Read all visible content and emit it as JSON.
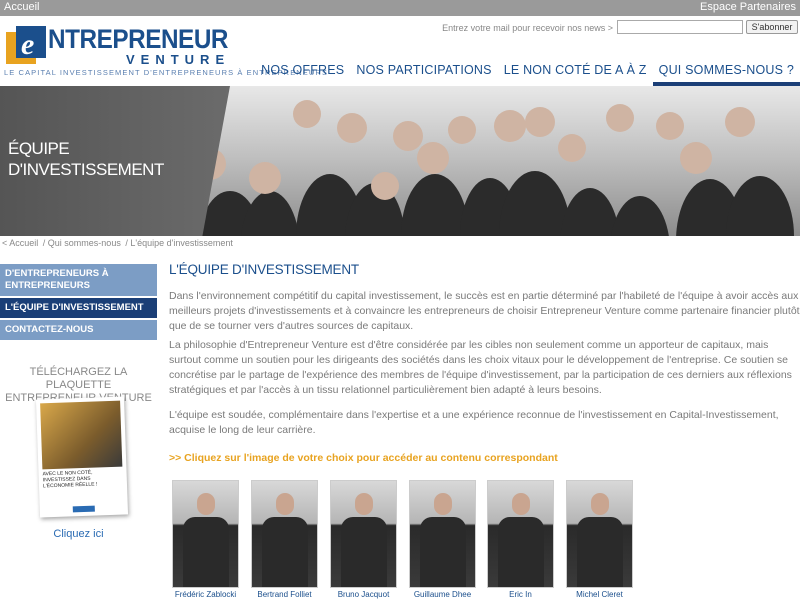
{
  "topbar": {
    "left": "Accueil",
    "right": "Espace Partenaires"
  },
  "logo": {
    "letter": "e",
    "word1": "NTREPRENEUR",
    "word2": "VENTURE",
    "tagline": "LE CAPITAL INVESTISSEMENT D'ENTREPRENEURS À ENTREPRENEURS"
  },
  "newsletter": {
    "label": "Entrez votre mail pour recevoir nos news >",
    "value": "",
    "button": "S'abonner"
  },
  "nav": [
    "NOS OFFRES",
    "NOS PARTICIPATIONS",
    "LE NON COTÉ DE A À Z",
    "QUI SOMMES-NOUS ?"
  ],
  "banner": {
    "title_line1": "ÉQUIPE",
    "title_line2": "D'INVESTISSEMENT"
  },
  "breadcrumb": [
    "< Accueil",
    "/ Qui sommes-nous",
    "/ L'équipe d'investissement"
  ],
  "sidebar": {
    "items": [
      "D'ENTREPRENEURS À ENTREPRENEURS",
      "L'ÉQUIPE D'INVESTISSEMENT",
      "CONTACTEZ-NOUS"
    ],
    "download_title": "TÉLÉCHARGEZ LA PLAQUETTE ENTREPRENEUR VENTURE",
    "cover_text": "AVEC LE NON COTÉ, INVESTISSEZ DANS L'ÉCONOMIE RÉELLE !",
    "download_link": "Cliquez ici"
  },
  "main": {
    "title": "L'ÉQUIPE D'INVESTISSEMENT",
    "p1": "Dans l'environnement compétitif du capital investissement, le succès est en partie déterminé par l'habileté de l'équipe à avoir accès aux meilleurs projets d'investissements et à convaincre les entrepreneurs de choisir Entrepreneur Venture comme partenaire financier plutôt que de se tourner vers d'autres sources de capitaux.",
    "p2": "La philosophie d'Entrepreneur Venture est d'être considérée par les cibles non seulement comme un apporteur de capitaux, mais surtout comme un soutien pour les dirigeants des sociétés dans les choix vitaux pour le développement de l'entreprise. Ce soutien se concrétise par le partage de l'expérience des membres de l'équipe d'investissement, par la participation de ces derniers aux réflexions stratégiques et par l'accès à un tissu relationnel particulièrement bien adapté à leurs besoins.",
    "p3": "L'équipe est soudée, complémentaire dans l'expertise et a une expérience reconnue de l'investissement en Capital-Investissement, acquise le long de leur carrière.",
    "cta": ">> Cliquez sur l'image de votre choix pour accéder au contenu correspondant"
  },
  "team": [
    "Frédéric Zablocki",
    "Bertrand Folliet",
    "Bruno Jacquot",
    "Guillaume Dhee",
    "Eric In",
    "Michel Cleret"
  ]
}
